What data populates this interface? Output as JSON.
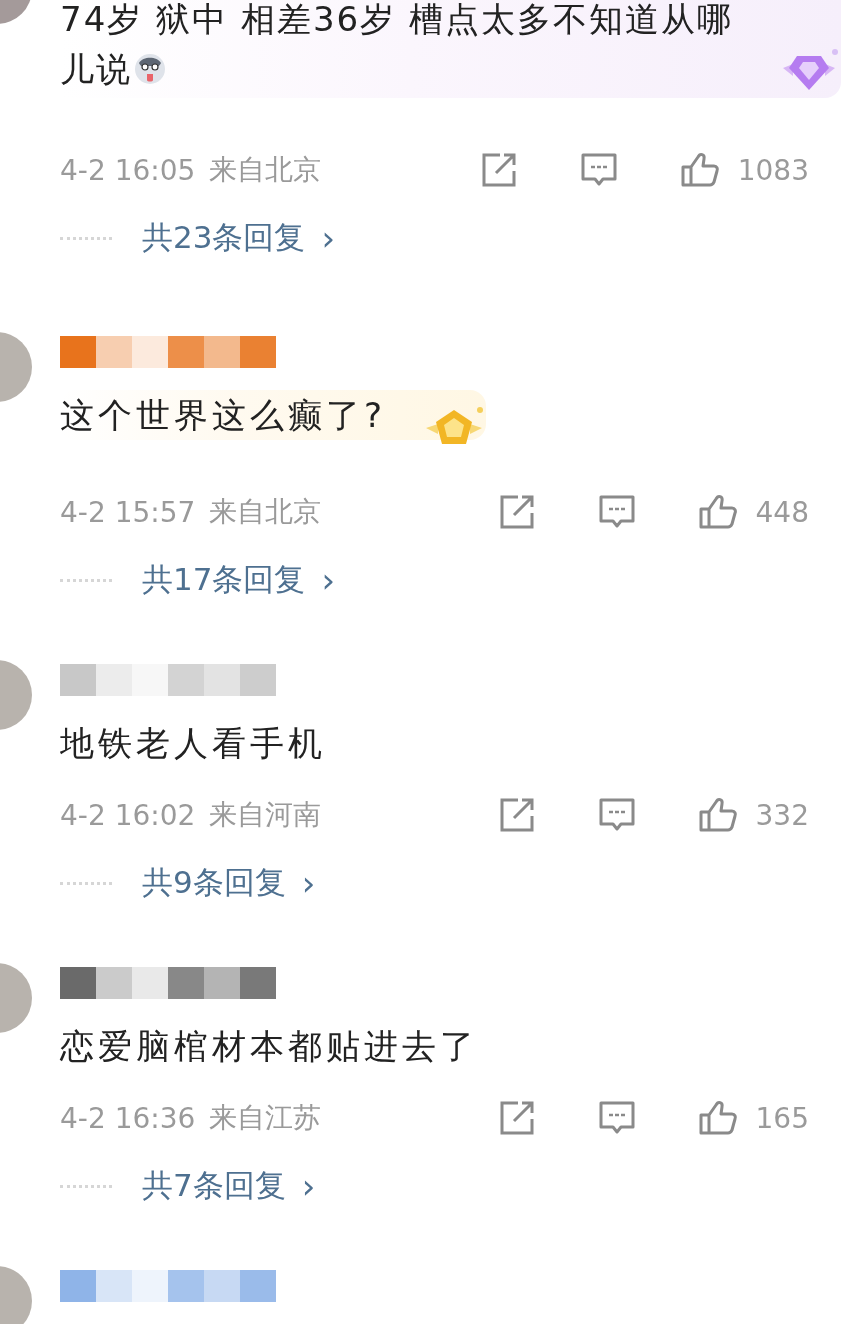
{
  "comments": [
    {
      "text": "74岁 狱中 相差36岁 槽点太多不知道从哪儿说",
      "emoji": true,
      "badge": {
        "kind": "diamond"
      },
      "time": "4-2 16:05",
      "location": "来自北京",
      "likes": "1083",
      "replies": "共23条回复",
      "reply_arrow": "›"
    },
    {
      "name_mosaic": {
        "color": "#e8731c"
      },
      "text": "这个世界这么癫了?",
      "badge": {
        "kind": "pentagon"
      },
      "time": "4-2 15:57",
      "location": "来自北京",
      "likes": "448",
      "replies": "共17条回复",
      "reply_arrow": "›"
    },
    {
      "name_mosaic": {
        "color": "#c8c8c8"
      },
      "text": "地铁老人看手机",
      "time": "4-2 16:02",
      "location": "来自河南",
      "likes": "332",
      "replies": "共9条回复",
      "reply_arrow": "›"
    },
    {
      "name_mosaic": {
        "color": "#6a6a6a"
      },
      "text": "恋爱脑棺材本都贴进去了",
      "time": "4-2 16:36",
      "location": "来自江苏",
      "likes": "165",
      "replies": "共7条回复",
      "reply_arrow": "›"
    },
    {
      "name_mosaic": {
        "color": "#8fb4e8"
      }
    }
  ]
}
